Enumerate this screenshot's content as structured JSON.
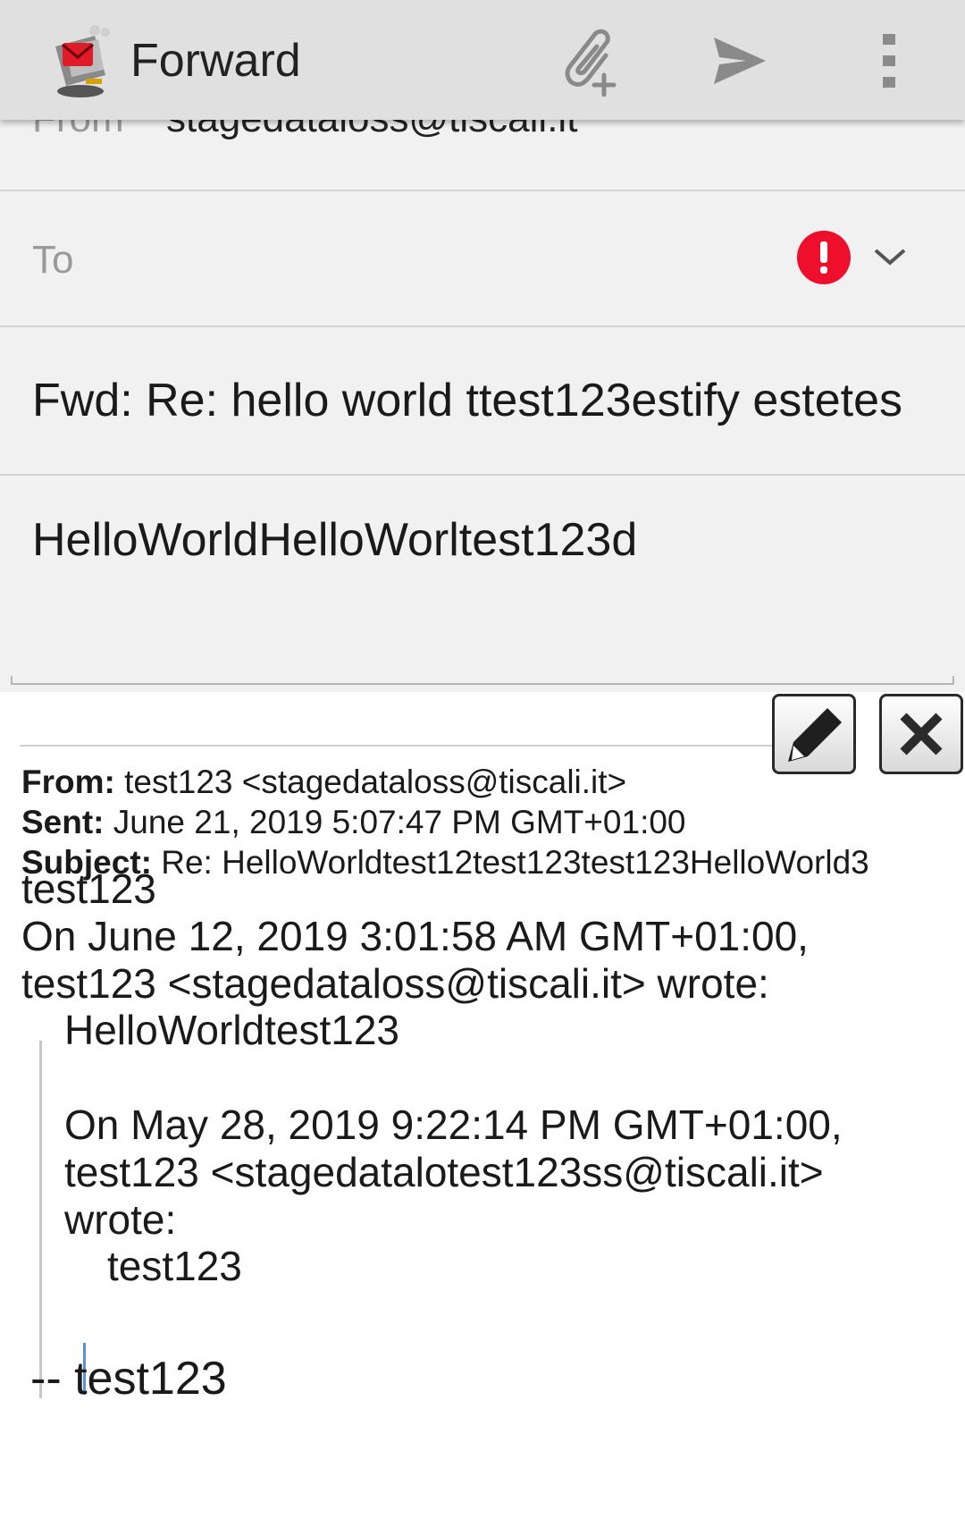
{
  "toolbar": {
    "title": "Forward",
    "attach_icon": "paperclip-plus-icon",
    "send_icon": "send-icon",
    "more_icon": "overflow-menu-icon",
    "background": "#e0e0e0"
  },
  "compose": {
    "from_label": "From",
    "from_value": "stagedataloss@tiscali.it",
    "to_label": "To",
    "to_warning_color": "#ee0f2d",
    "subject": "Fwd: Re: hello world ttest123estify estetes",
    "body": "HelloWorldHelloWorltest123d"
  },
  "quoted": {
    "from_label": "From:",
    "from_value": "test123 <stagedataloss@tiscali.it>",
    "sent_label": "Sent:",
    "sent_value": "June 21, 2019 5:07:47 PM GMT+01:00",
    "subject_label": "Subject:",
    "subject_value": "Re: HelloWorldtest12test123test123HelloWorld3",
    "line1": "test123",
    "line2": "On June 12, 2019 3:01:58 AM GMT+01:00,",
    "line3": "test123 <stagedataloss@tiscali.it> wrote:",
    "nested_line1": "HelloWorldtest123",
    "nested_line2": "On May 28, 2019 9:22:14 PM GMT+01:00,",
    "nested_line3": "test123 <stagedatalotest123ss@tiscali.it>",
    "nested_line4": "wrote:",
    "deep_line1": "test123",
    "signature": "-- test123"
  }
}
